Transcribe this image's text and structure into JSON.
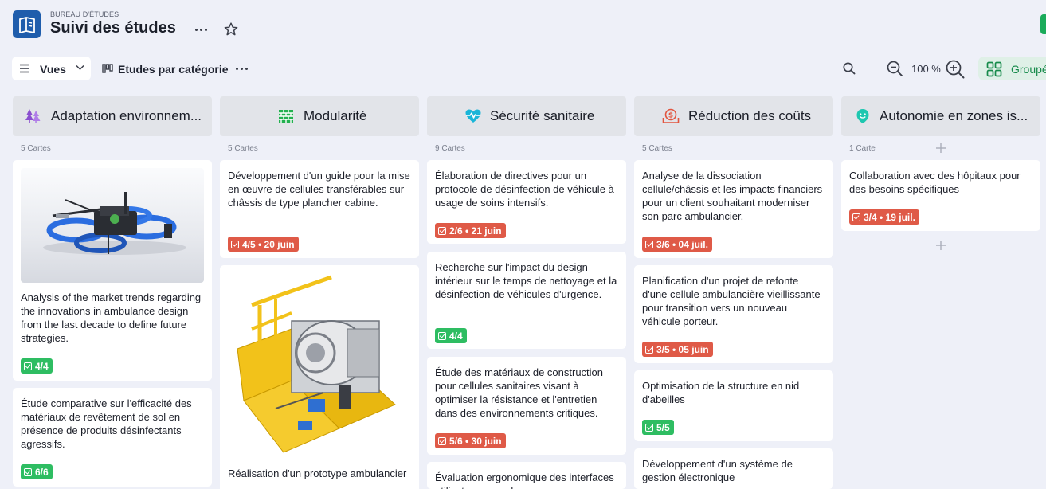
{
  "header": {
    "eyebrow": "BUREAU D'ÉTUDES",
    "title": "Suivi des études"
  },
  "toolbar": {
    "views_label": "Vues",
    "view_name": "Etudes par catégorie",
    "zoom_level": "100 %",
    "group_label": "Groupé"
  },
  "colors": {
    "accent_blue": "#1f5dac",
    "success_green": "#2ebd62",
    "late_red": "#df5a47"
  },
  "columns": [
    {
      "title": "Adaptation environnem...",
      "icon": "trees-icon",
      "count": "5 Cartes",
      "cards": [
        {
          "image": "drone-icon",
          "text": "Analysis of the market trends regarding the innovations in ambulance design from the last decade to define future strategies.",
          "badge": "4/4",
          "status": "green"
        },
        {
          "text": "Étude comparative sur l'efficacité des matériaux de revêtement de sol en présence de produits désinfectants agressifs.",
          "badge": "6/6",
          "status": "green"
        }
      ]
    },
    {
      "title": "Modularité",
      "icon": "brick-wall-icon",
      "count": "5 Cartes",
      "cards": [
        {
          "text": "Développement d'un guide pour la mise en œuvre de cellules transférables sur châssis de type plancher cabine.",
          "badge": "4/5 • 20 juin",
          "status": "red"
        },
        {
          "image": "machine-icon",
          "text": "Réalisation d'un prototype ambulancier"
        }
      ]
    },
    {
      "title": "Sécurité sanitaire",
      "icon": "heartbeat-icon",
      "count": "9 Cartes",
      "cards": [
        {
          "text": "Élaboration de directives pour un protocole de désinfection de véhicule à usage de soins intensifs.",
          "badge": "2/6 • 21 juin",
          "status": "red"
        },
        {
          "text": "Recherche sur l'impact du design intérieur sur le temps de nettoyage et la désinfection de véhicules d'urgence.",
          "badge": "4/4",
          "status": "green"
        },
        {
          "text": "Étude des matériaux de construction pour cellules sanitaires visant à optimiser la résistance et l'entretien dans des environnements critiques.",
          "badge": "5/6 • 30 juin",
          "status": "red"
        },
        {
          "text": "Évaluation ergonomique des interfaces utilisateurs pour les"
        }
      ]
    },
    {
      "title": "Réduction des coûts",
      "icon": "money-icon",
      "count": "5 Cartes",
      "cards": [
        {
          "text": "Analyse de la dissociation cellule/châssis et les impacts financiers pour un client souhaitant moderniser son parc ambulancier.",
          "badge": "3/6 • 04 juil.",
          "status": "red"
        },
        {
          "text": "Planification d'un projet de refonte d'une cellule ambulancière vieillissante pour transition vers un nouveau véhicule porteur.",
          "badge": "3/5 • 05 juin",
          "status": "red"
        },
        {
          "text": "Optimisation de la structure en nid d'abeilles",
          "badge": "5/5",
          "status": "green"
        },
        {
          "text": "Développement d'un système de gestion électronique"
        }
      ]
    },
    {
      "title": "Autonomie en zones is...",
      "icon": "smiley-icon",
      "count": "1 Carte",
      "cards": [
        {
          "text": "Collaboration avec des hôpitaux pour des besoins spécifiques",
          "badge": "3/4 • 19 juil.",
          "status": "red"
        }
      ]
    }
  ]
}
